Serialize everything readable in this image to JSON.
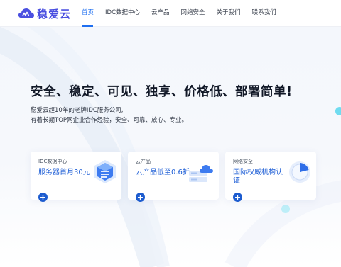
{
  "header": {
    "logo_text": "稳爱云",
    "nav": [
      {
        "label": "首页",
        "active": true
      },
      {
        "label": "IDC数据中心",
        "active": false
      },
      {
        "label": "云产品",
        "active": false
      },
      {
        "label": "网络安全",
        "active": false
      },
      {
        "label": "关于我们",
        "active": false
      },
      {
        "label": "联系我们",
        "active": false
      }
    ]
  },
  "hero": {
    "headline": "安全、稳定、可见、独享、价格低、部署简单!",
    "sub_line1": "稳爱云超10年的老牌IDC服务公司,",
    "sub_line2": "有着长期TOP网企业合作经验，安全、可靠、放心、专业。"
  },
  "cards": [
    {
      "tag": "IDC数据中心",
      "title": "服务器首月30元",
      "icon": "server-cube-icon",
      "plus": "+"
    },
    {
      "tag": "云产品",
      "title": "云产品低至0.6折",
      "icon": "cloud-server-icon",
      "plus": "+"
    },
    {
      "tag": "网络安全",
      "title": "国际权威机构认证",
      "icon": "security-pie-icon",
      "plus": "+"
    }
  ],
  "colors": {
    "brand": "#4a4fe0",
    "accent": "#1f6ff0",
    "card_title": "#1f5fd6",
    "plus_button": "#1d5ccf",
    "deco_cyan": "#5fd8ee"
  }
}
